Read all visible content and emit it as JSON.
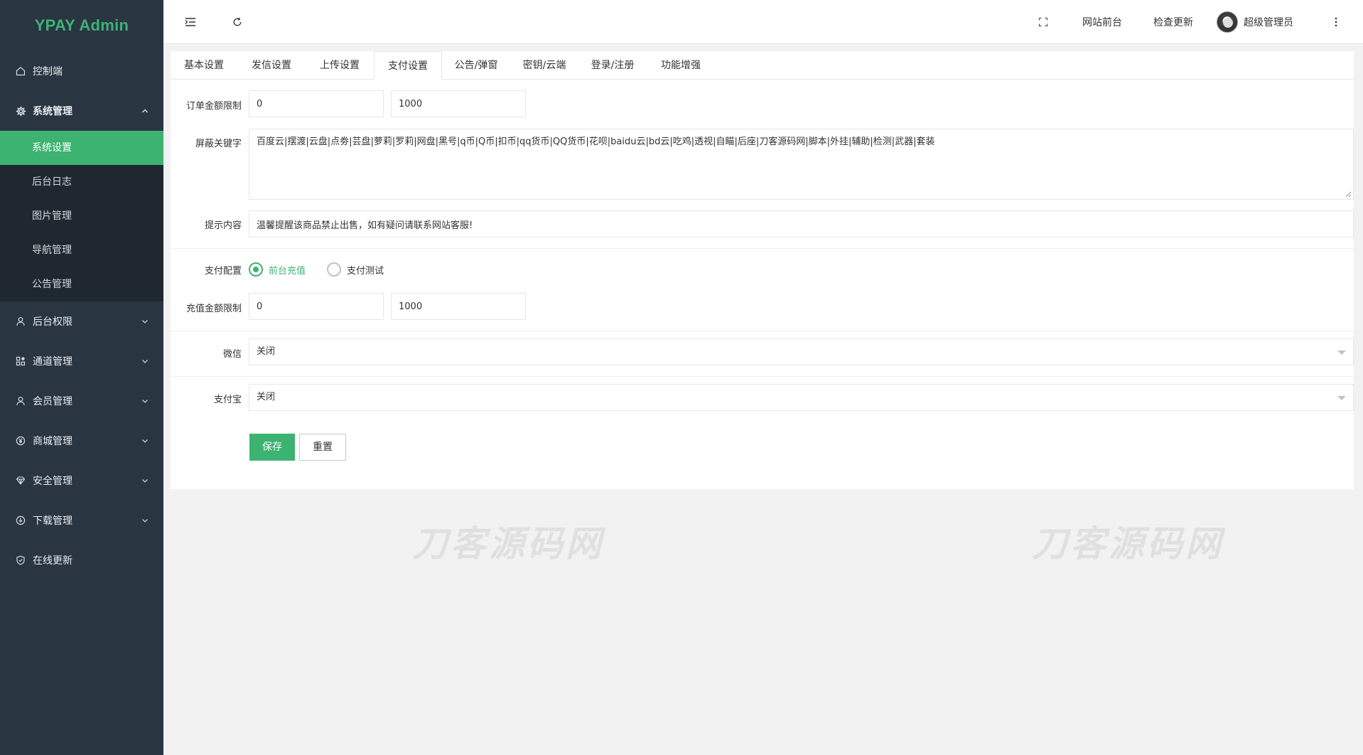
{
  "app": {
    "title": "YPAY Admin"
  },
  "sidebar": {
    "items": [
      {
        "label": "控制端",
        "icon": "home-icon"
      },
      {
        "label": "系统管理",
        "icon": "gear-icon",
        "expanded": true,
        "children": [
          {
            "label": "系统设置",
            "active": true
          },
          {
            "label": "后台日志"
          },
          {
            "label": "图片管理"
          },
          {
            "label": "导航管理"
          },
          {
            "label": "公告管理"
          }
        ]
      },
      {
        "label": "后台权限",
        "icon": "user-icon"
      },
      {
        "label": "通道管理",
        "icon": "grid-icon"
      },
      {
        "label": "会员管理",
        "icon": "user-icon"
      },
      {
        "label": "商城管理",
        "icon": "yen-icon"
      },
      {
        "label": "安全管理",
        "icon": "diamond-icon"
      },
      {
        "label": "下载管理",
        "icon": "download-icon"
      },
      {
        "label": "在线更新",
        "icon": "shield-check-icon"
      }
    ]
  },
  "header": {
    "frontend_label": "网站前台",
    "check_update_label": "检查更新",
    "user_name": "超级管理员"
  },
  "tabs": [
    {
      "label": "基本设置"
    },
    {
      "label": "发信设置"
    },
    {
      "label": "上传设置"
    },
    {
      "label": "支付设置",
      "active": true
    },
    {
      "label": "公告/弹窗"
    },
    {
      "label": "密钥/云端"
    },
    {
      "label": "登录/注册"
    },
    {
      "label": "功能增强"
    }
  ],
  "form": {
    "order_limit": {
      "label": "订单金额限制",
      "min": "0",
      "max": "1000"
    },
    "blocked_keywords": {
      "label": "屏蔽关键字",
      "value": "百度云|摆渡|云盘|点劵|芸盘|萝莉|罗莉|网盘|黑号|q币|Q币|扣币|qq货币|QQ货币|花呗|baidu云|bd云|吃鸡|透视|自瞄|后座|刀客源码网|脚本|外挂|辅助|检测|武器|套装"
    },
    "tip_content": {
      "label": "提示内容",
      "value": "温馨提醒该商品禁止出售，如有疑问请联系网站客服!"
    },
    "pay_config": {
      "label": "支付配置",
      "options": [
        "前台充值",
        "支付测试"
      ],
      "selected": "前台充值"
    },
    "recharge_limit": {
      "label": "充值金额限制",
      "min": "0",
      "max": "1000"
    },
    "wechat": {
      "label": "微信",
      "value": "关闭"
    },
    "alipay": {
      "label": "支付宝",
      "value": "关闭"
    },
    "save_label": "保存",
    "reset_label": "重置"
  },
  "watermark_text": "刀客源码网",
  "colors": {
    "accent": "#3cb371",
    "sidebar_bg": "#2a3542",
    "submenu_bg": "#1f2831"
  }
}
